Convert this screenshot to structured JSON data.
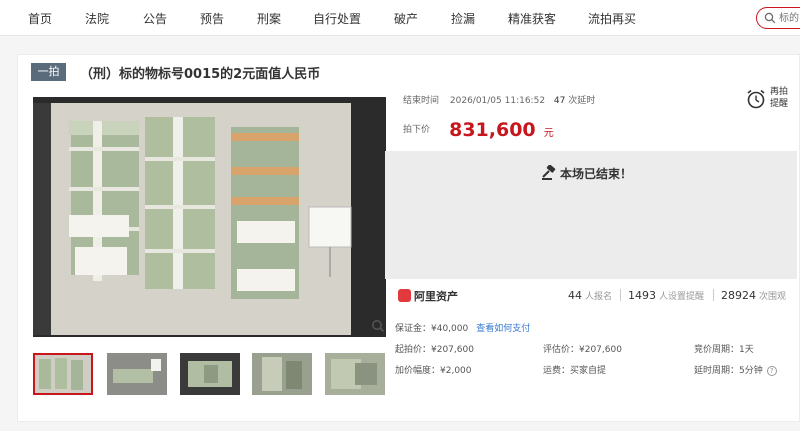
{
  "nav": {
    "items": [
      "首页",
      "法院",
      "公告",
      "预告",
      "刑案",
      "自行处置",
      "破产",
      "捡漏",
      "精准获客",
      "流拍再买"
    ],
    "search_placeholder": "标的"
  },
  "item": {
    "badge": "一拍",
    "title": "（刑）标的物标号0015的2元面值人民币"
  },
  "auction": {
    "end_label": "结束时间",
    "end_time": "2026/01/05 11:16:52",
    "delay_count": "47",
    "delay_label": "次延时",
    "remind_line1": "再拍",
    "remind_line2": "提醒",
    "price_label": "拍下价",
    "price": "831,600",
    "price_unit": "元",
    "ended_text": "本场已结束！"
  },
  "stats": {
    "platform": "阿里资产",
    "signups": "44",
    "signups_label": "人报名",
    "reminders": "1493",
    "reminders_label": "人设置提醒",
    "views": "28924",
    "views_label": "次围观"
  },
  "details": {
    "deposit": "保证金：¥40,000",
    "deposit_link": "查看如何支付",
    "start_price": "起拍价：¥207,600",
    "appraisal": "评估价：¥207,600",
    "bid_cycle": "竞价周期：1天",
    "increment": "加价幅度：¥2,000",
    "shipping": "运费：买家自提",
    "delay_cycle": "延时周期：5分钟"
  },
  "colors": {
    "accent": "#c8161d",
    "badge": "#5a6b7c",
    "link": "#3478d4"
  },
  "icons": [
    "search-icon",
    "alarm-clock-icon",
    "gavel-icon",
    "zoom-icon",
    "question-icon"
  ]
}
